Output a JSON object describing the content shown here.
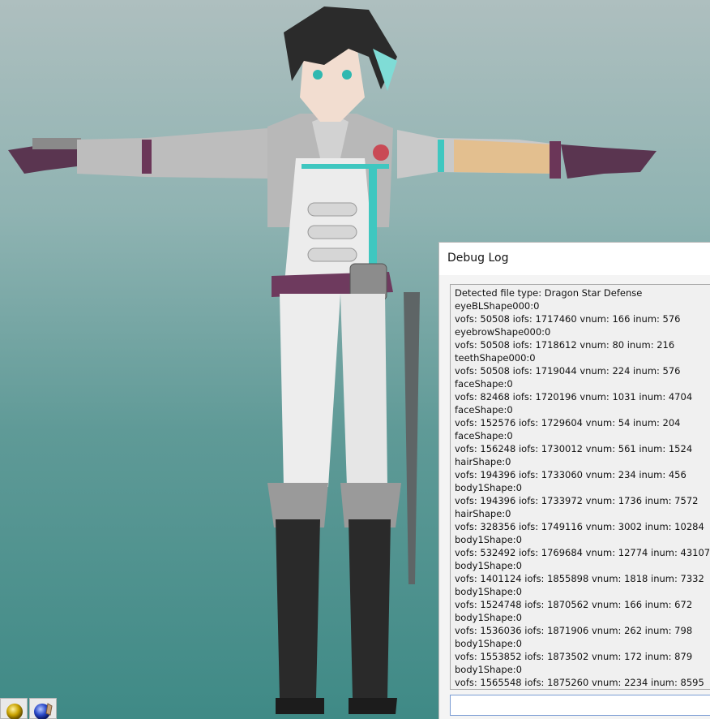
{
  "debug_window": {
    "title": "Debug Log",
    "input_value": "",
    "lines": [
      "Detected file type: Dragon Star Defense",
      "eyeBLShape000:0",
      "vofs: 50508 iofs: 1717460 vnum: 166 inum: 576",
      "eyebrowShape000:0",
      "vofs: 50508 iofs: 1718612 vnum: 80 inum: 216",
      "teethShape000:0",
      "vofs: 50508 iofs: 1719044 vnum: 224 inum: 576",
      "faceShape:0",
      "vofs: 82468 iofs: 1720196 vnum: 1031 inum: 4704",
      "faceShape:0",
      "vofs: 152576 iofs: 1729604 vnum: 54 inum: 204",
      "faceShape:0",
      "vofs: 156248 iofs: 1730012 vnum: 561 inum: 1524",
      "hairShape:0",
      "vofs: 194396 iofs: 1733060 vnum: 234 inum: 456",
      "body1Shape:0",
      "vofs: 194396 iofs: 1733972 vnum: 1736 inum: 7572",
      "hairShape:0",
      "vofs: 328356 iofs: 1749116 vnum: 3002 inum: 10284",
      "body1Shape:0",
      "vofs: 532492 iofs: 1769684 vnum: 12774 inum: 43107",
      "body1Shape:0",
      "vofs: 1401124 iofs: 1855898 vnum: 1818 inum: 7332",
      "body1Shape:0",
      "vofs: 1524748 iofs: 1870562 vnum: 166 inum: 672",
      "body1Shape:0",
      "vofs: 1536036 iofs: 1871906 vnum: 262 inum: 798",
      "body1Shape:0",
      "vofs: 1553852 iofs: 1873502 vnum: 172 inum: 879",
      "body1Shape:0",
      "vofs: 1565548 iofs: 1875260 vnum: 2234 inum: 8595"
    ]
  },
  "toolbar": {
    "buttons": [
      {
        "icon": "gold-sphere-icon"
      },
      {
        "icon": "blue-sphere-hand-icon"
      }
    ]
  },
  "colors": {
    "background_top": "#aebfbf",
    "background_bottom": "#3f8a86",
    "accent_teal": "#3fc7c0",
    "belt_purple": "#6e3a5e"
  }
}
